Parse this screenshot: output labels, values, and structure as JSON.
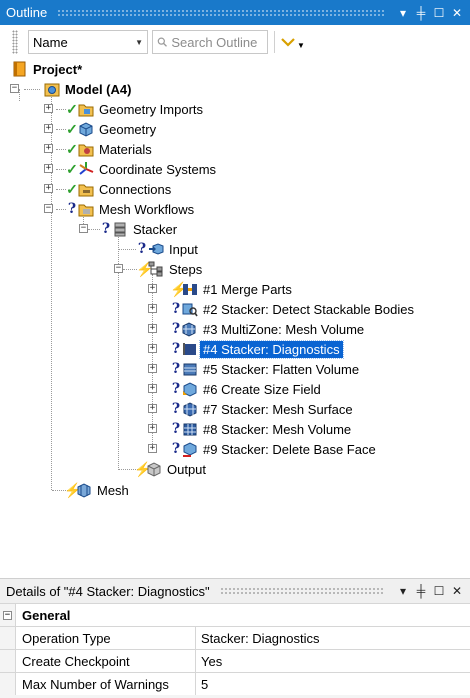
{
  "outline": {
    "title": "Outline",
    "controls": [
      "▾",
      "╪",
      "☐",
      "✕"
    ]
  },
  "toolbar": {
    "sort_combo_value": "Name",
    "search_placeholder": "Search Outline"
  },
  "tree": {
    "project": "Project*",
    "model": "Model (A4)",
    "geometry_imports": "Geometry Imports",
    "geometry": "Geometry",
    "materials": "Materials",
    "coordinate_systems": "Coordinate Systems",
    "connections": "Connections",
    "mesh_workflows": "Mesh Workflows",
    "stacker": "Stacker",
    "input": "Input",
    "steps": "Steps",
    "step1": "#1 Merge Parts",
    "step2": "#2 Stacker: Detect Stackable Bodies",
    "step3": "#3 MultiZone: Mesh Volume",
    "step4": "#4 Stacker: Diagnostics",
    "step5": "#5 Stacker: Flatten Volume",
    "step6": "#6 Create Size Field",
    "step7": "#7 Stacker: Mesh Surface",
    "step8": "#8 Stacker: Mesh Volume",
    "step9": "#9 Stacker: Delete Base Face",
    "output": "Output",
    "mesh": "Mesh"
  },
  "details": {
    "title": "Details of \"#4 Stacker: Diagnostics\"",
    "group": "General",
    "rows": [
      {
        "key": "Operation Type",
        "value": "Stacker: Diagnostics"
      },
      {
        "key": "Create Checkpoint",
        "value": "Yes"
      },
      {
        "key": "Max Number of Warnings",
        "value": "5"
      }
    ]
  },
  "colors": {
    "titlebar": "#1979ca",
    "selection": "#0a64d2",
    "check": "#2ea02e",
    "question": "#1a2a8a",
    "bolt": "#f0c000"
  }
}
